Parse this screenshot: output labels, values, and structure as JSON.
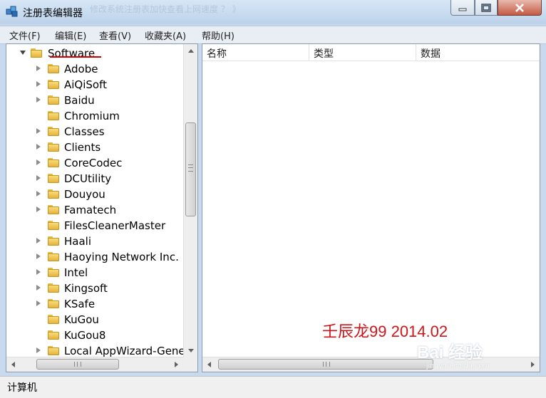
{
  "window": {
    "title": "注册表编辑器",
    "title_ghost": "修改系统注册表加快查看上网速度 ？ 》"
  },
  "menu": {
    "items": [
      "文件(F)",
      "编辑(E)",
      "查看(V)",
      "收藏夹(A)",
      "帮助(H)"
    ]
  },
  "tree": {
    "root": "Software",
    "items": [
      {
        "label": "Adobe",
        "expandable": true
      },
      {
        "label": "AiQiSoft",
        "expandable": true
      },
      {
        "label": "Baidu",
        "expandable": true
      },
      {
        "label": "Chromium",
        "expandable": false
      },
      {
        "label": "Classes",
        "expandable": true
      },
      {
        "label": "Clients",
        "expandable": true
      },
      {
        "label": "CoreCodec",
        "expandable": true
      },
      {
        "label": "DCUtility",
        "expandable": true
      },
      {
        "label": "Douyou",
        "expandable": true
      },
      {
        "label": "Famatech",
        "expandable": true
      },
      {
        "label": "FilesCleanerMaster",
        "expandable": false
      },
      {
        "label": "Haali",
        "expandable": true
      },
      {
        "label": "Haoying Network Inc.",
        "expandable": true
      },
      {
        "label": "Intel",
        "expandable": true
      },
      {
        "label": "Kingsoft",
        "expandable": true
      },
      {
        "label": "KSafe",
        "expandable": true
      },
      {
        "label": "KuGou",
        "expandable": false
      },
      {
        "label": "KuGou8",
        "expandable": false
      },
      {
        "label": "Local AppWizard-Gene",
        "expandable": true
      }
    ]
  },
  "list": {
    "columns": [
      "名称",
      "类型",
      "数据"
    ]
  },
  "watermark": {
    "text": "壬辰龙99 2014.02",
    "color": "#d0151a"
  },
  "baidu": {
    "logo": "Bai 经验",
    "url": "jingyan.baidu.com"
  },
  "status": {
    "text": "计算机"
  },
  "colors": {
    "accent_red": "#d00000",
    "folder": "#e7b33b",
    "titlebar": "#c9daee"
  }
}
